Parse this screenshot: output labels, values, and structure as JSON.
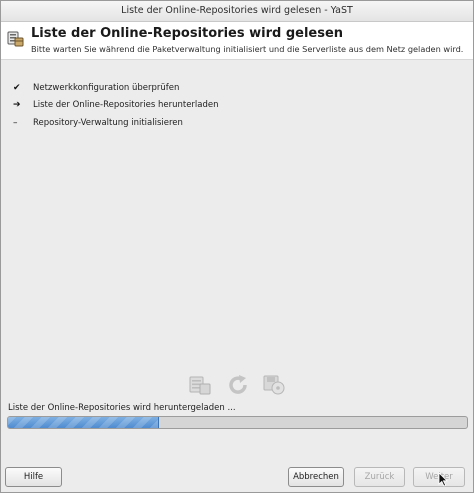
{
  "window": {
    "title": "Liste der Online-Repositories wird gelesen - YaST"
  },
  "header": {
    "icon": "package-repository-icon",
    "title": "Liste der Online-Repositories wird gelesen",
    "subtitle": "Bitte warten Sie während die Paketverwaltung initialisiert und die Serverliste aus dem Netz geladen wird."
  },
  "steps": [
    {
      "mark": "✔",
      "state": "done",
      "label": "Netzwerkkonfiguration überprüfen"
    },
    {
      "mark": "➔",
      "state": "current",
      "label": "Liste der Online-Repositories herunterladen"
    },
    {
      "mark": "–",
      "state": "pending",
      "label": "Repository-Verwaltung initialisieren"
    }
  ],
  "status_icons": [
    "repository-list-icon",
    "refresh-icon",
    "disk-icon"
  ],
  "progress": {
    "label": "Liste der Online-Repositories wird heruntergeladen ...",
    "fraction": 0.33
  },
  "buttons": {
    "help": "Hilfe",
    "abort": "Abbrechen",
    "back": "Zurück",
    "next": "Weiter"
  },
  "colors": {
    "progress_fill": "#5b95d6",
    "disabled_text": "#a6a6a6"
  }
}
